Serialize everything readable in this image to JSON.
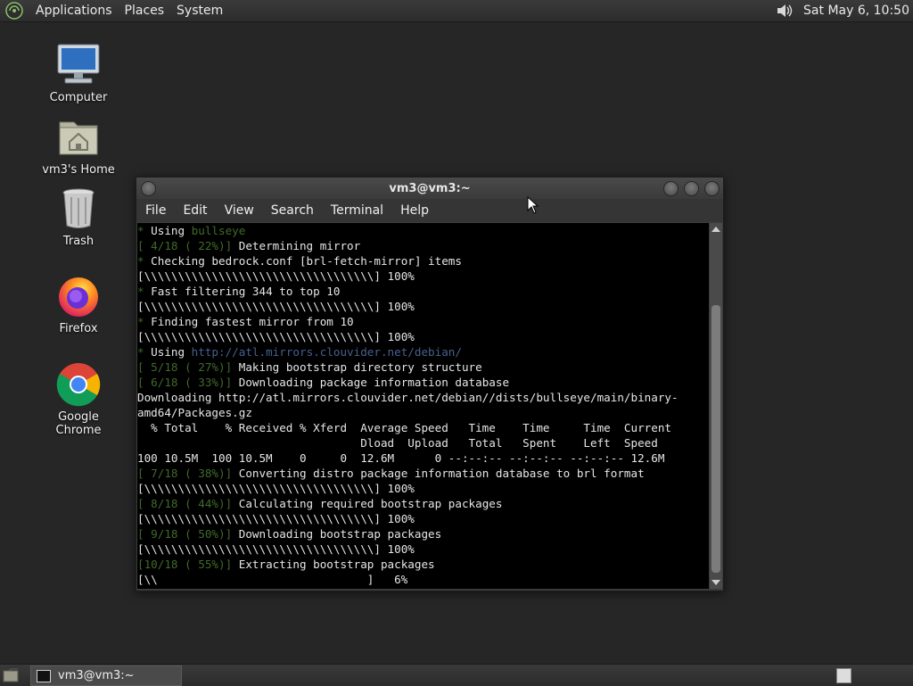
{
  "top_panel": {
    "menus": [
      "Applications",
      "Places",
      "System"
    ],
    "clock": "Sat May  6, 10:50"
  },
  "desktop_icons": [
    {
      "label": "Computer",
      "icon": "computer-icon"
    },
    {
      "label": "vm3's Home",
      "icon": "home-folder-icon"
    },
    {
      "label": "Trash",
      "icon": "trash-icon"
    },
    {
      "label": "Firefox",
      "icon": "firefox-icon"
    },
    {
      "label": "Google Chrome",
      "icon": "chrome-icon"
    }
  ],
  "window": {
    "title": "vm3@vm3:~",
    "menus": [
      "File",
      "Edit",
      "View",
      "Search",
      "Terminal",
      "Help"
    ]
  },
  "terminal_lines": [
    [
      {
        "t": "* ",
        "c": "g"
      },
      {
        "t": "Using "
      },
      {
        "t": "bullseye",
        "c": "g"
      }
    ],
    [
      {
        "t": "[ 4/18 ( 22%)]",
        "c": "g"
      },
      {
        "t": " Determining mirror"
      }
    ],
    [
      {
        "t": "* ",
        "c": "g"
      },
      {
        "t": "Checking bedrock.conf [brl-fetch-mirror] items"
      }
    ],
    [
      {
        "t": "[\\\\\\\\\\\\\\\\\\\\\\\\\\\\\\\\\\\\\\\\\\\\\\\\\\\\\\\\\\\\\\\\\\\\] 100%"
      }
    ],
    [
      {
        "t": "* ",
        "c": "g"
      },
      {
        "t": "Fast filtering 344 to top 10"
      }
    ],
    [
      {
        "t": "[\\\\\\\\\\\\\\\\\\\\\\\\\\\\\\\\\\\\\\\\\\\\\\\\\\\\\\\\\\\\\\\\\\\\] 100%"
      }
    ],
    [
      {
        "t": "* ",
        "c": "g"
      },
      {
        "t": "Finding fastest mirror from 10"
      }
    ],
    [
      {
        "t": "[\\\\\\\\\\\\\\\\\\\\\\\\\\\\\\\\\\\\\\\\\\\\\\\\\\\\\\\\\\\\\\\\\\\\] 100%"
      }
    ],
    [
      {
        "t": "* ",
        "c": "g"
      },
      {
        "t": "Using "
      },
      {
        "t": "http://atl.mirrors.clouvider.net/debian/",
        "c": "b"
      }
    ],
    [
      {
        "t": "[ 5/18 ( 27%)]",
        "c": "g"
      },
      {
        "t": " Making bootstrap directory structure"
      }
    ],
    [
      {
        "t": "[ 6/18 ( 33%)]",
        "c": "g"
      },
      {
        "t": " Downloading package information database"
      }
    ],
    [
      {
        "t": "Downloading http://atl.mirrors.clouvider.net/debian//dists/bullseye/main/binary-"
      }
    ],
    [
      {
        "t": "amd64/Packages.gz"
      }
    ],
    [
      {
        "t": "  % Total    % Received % Xferd  Average Speed   Time    Time     Time  Current"
      }
    ],
    [
      {
        "t": "                                 Dload  Upload   Total   Spent    Left  Speed"
      }
    ],
    [
      {
        "t": "100 10.5M  100 10.5M    0     0  12.6M      0 --:--:-- --:--:-- --:--:-- 12.6M"
      }
    ],
    [
      {
        "t": "[ 7/18 ( 38%)]",
        "c": "g"
      },
      {
        "t": " Converting distro package information database to brl format"
      }
    ],
    [
      {
        "t": "[\\\\\\\\\\\\\\\\\\\\\\\\\\\\\\\\\\\\\\\\\\\\\\\\\\\\\\\\\\\\\\\\\\\\] 100%"
      }
    ],
    [
      {
        "t": "[ 8/18 ( 44%)]",
        "c": "g"
      },
      {
        "t": " Calculating required bootstrap packages"
      }
    ],
    [
      {
        "t": "[\\\\\\\\\\\\\\\\\\\\\\\\\\\\\\\\\\\\\\\\\\\\\\\\\\\\\\\\\\\\\\\\\\\\] 100%"
      }
    ],
    [
      {
        "t": "[ 9/18 ( 50%)]",
        "c": "g"
      },
      {
        "t": " Downloading bootstrap packages"
      }
    ],
    [
      {
        "t": "[\\\\\\\\\\\\\\\\\\\\\\\\\\\\\\\\\\\\\\\\\\\\\\\\\\\\\\\\\\\\\\\\\\\\] 100%"
      }
    ],
    [
      {
        "t": "[10/18 ( 55%)]",
        "c": "g"
      },
      {
        "t": " Extracting bootstrap packages"
      }
    ],
    [
      {
        "t": "[\\\\                               ]   6%"
      }
    ]
  ],
  "taskbar": {
    "task_label": "vm3@vm3:~"
  },
  "colors": {
    "terminal_green": "#3f6b2b",
    "terminal_blue": "#46608f",
    "desktop_bg": "#262626"
  }
}
